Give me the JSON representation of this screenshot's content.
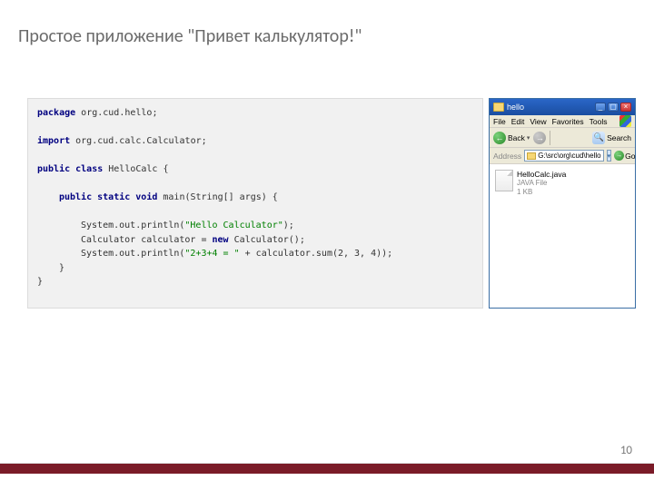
{
  "slide": {
    "title": "Простое приложение \"Привет калькулятор!\"",
    "page_number": "10"
  },
  "code": {
    "package_kw": "package",
    "package_name": " org.cud.hello;",
    "import_kw": "import",
    "import_name": " org.cud.calc.Calculator;",
    "pc_kw": "public class",
    "class_name": " HelloCalc {",
    "method_kw": "public static void",
    "method_sig": " main(String[] args) {",
    "line1a": "System.out.println(",
    "line1str": "\"Hello Calculator\"",
    "line1b": ");",
    "line2a": "Calculator calculator = ",
    "line2kw": "new",
    "line2b": " Calculator();",
    "line3a": "System.out.println(",
    "line3str": "\"2+3+4 = \"",
    "line3b": " + calculator.sum(2, 3, 4));",
    "close_method": "}",
    "close_class": "}"
  },
  "explorer": {
    "title": "hello",
    "menu": {
      "file": "File",
      "edit": "Edit",
      "view": "View",
      "favorites": "Favorites",
      "tools": "Tools"
    },
    "toolbar": {
      "back": "Back",
      "search": "Search"
    },
    "address": {
      "label": "Address",
      "path": "G:\\src\\org\\cud\\hello",
      "go": "Go"
    },
    "file": {
      "name": "HelloCalc.java",
      "type": "JAVA File",
      "size": "1 KB"
    }
  }
}
